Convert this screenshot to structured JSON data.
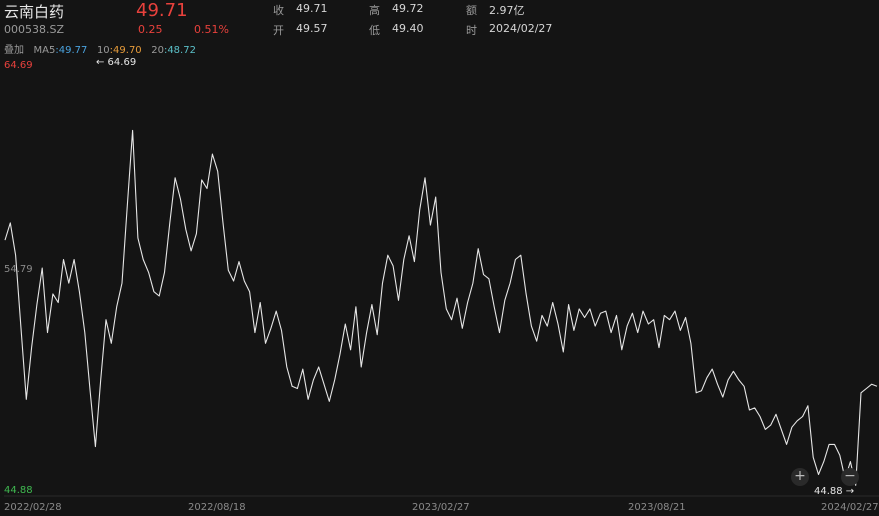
{
  "header": {
    "name": "云南白药",
    "code": "000538.SZ",
    "price": "49.71",
    "change": "0.25",
    "change_pct": "0.51%",
    "stats": [
      {
        "label": "收",
        "value": "49.71"
      },
      {
        "label": "高",
        "value": "49.72"
      },
      {
        "label": "额",
        "value": "2.97亿"
      },
      {
        "label": "开",
        "value": "49.57"
      },
      {
        "label": "低",
        "value": "49.40"
      },
      {
        "label": "时",
        "value": "2024/02/27"
      }
    ]
  },
  "ma": {
    "overlay_label": "叠加",
    "ma5_label": "MA5",
    "ma5_value": ":49.77",
    "ma10_label": "10",
    "ma10_value": ":49.70",
    "ma20_label": "20",
    "ma20_value": ":48.72"
  },
  "axis": {
    "y_max_label": "64.69",
    "y_min_label": "44.88",
    "y_mid_label": "54.79",
    "max_marker": "← 64.69",
    "min_marker": "44.88 →",
    "x_ticks": [
      "2022/02/28",
      "2022/08/18",
      "2023/02/27",
      "2023/08/21",
      "2024/02/27"
    ]
  },
  "zoom": {
    "in": "+",
    "out": "−"
  },
  "colors": {
    "up": "#e8413c",
    "down": "#3fb950",
    "line": "#e6e6e6",
    "bg": "#141414"
  },
  "chart_data": {
    "type": "line",
    "y_axis": {
      "min": 44.88,
      "max": 64.69
    },
    "x_range": [
      "2022/02/28",
      "2024/02/27"
    ],
    "series": [
      {
        "values": [
          56.5,
          57.3,
          55.8,
          52.4,
          49.1,
          51.5,
          53.5,
          55.2,
          52.2,
          54.0,
          53.6,
          55.6,
          54.5,
          55.6,
          54.1,
          52.2,
          49.5,
          46.9,
          50.0,
          52.8,
          51.7,
          53.4,
          54.5,
          58.1,
          61.6,
          56.6,
          55.6,
          55.0,
          54.1,
          53.9,
          55.0,
          57.3,
          59.4,
          58.4,
          57.0,
          56.0,
          56.8,
          59.3,
          58.9,
          60.5,
          59.7,
          57.3,
          55.1,
          54.6,
          55.5,
          54.6,
          54.1,
          52.2,
          53.6,
          51.7,
          52.4,
          53.2,
          52.3,
          50.6,
          49.7,
          49.6,
          50.5,
          49.1,
          50.0,
          50.6,
          49.8,
          49.0,
          50.0,
          51.2,
          52.6,
          51.4,
          53.4,
          50.6,
          52.2,
          53.5,
          52.1,
          54.5,
          55.8,
          55.3,
          53.7,
          55.6,
          56.7,
          55.5,
          57.9,
          59.4,
          57.2,
          58.5,
          55.0,
          53.3,
          52.8,
          53.8,
          52.4,
          53.6,
          54.5,
          56.1,
          54.9,
          54.7,
          53.4,
          52.2,
          53.7,
          54.5,
          55.6,
          55.8,
          54.0,
          52.5,
          51.8,
          53.0,
          52.5,
          53.6,
          52.6,
          51.3,
          53.5,
          52.3,
          53.3,
          52.9,
          53.3,
          52.5,
          53.1,
          53.2,
          52.2,
          53.0,
          51.4,
          52.5,
          53.1,
          52.2,
          53.2,
          52.6,
          52.8,
          51.5,
          53.0,
          52.8,
          53.2,
          52.3,
          52.9,
          51.7,
          49.4,
          49.5,
          50.1,
          50.5,
          49.8,
          49.2,
          50.0,
          50.4,
          50.0,
          49.7,
          48.6,
          48.7,
          48.3,
          47.7,
          47.9,
          48.4,
          47.7,
          47.0,
          47.8,
          48.1,
          48.3,
          48.8,
          46.4,
          45.6,
          46.2,
          47.0,
          47.0,
          46.5,
          45.4,
          46.2,
          45.1,
          49.4,
          49.6,
          49.8,
          49.7
        ]
      }
    ]
  }
}
